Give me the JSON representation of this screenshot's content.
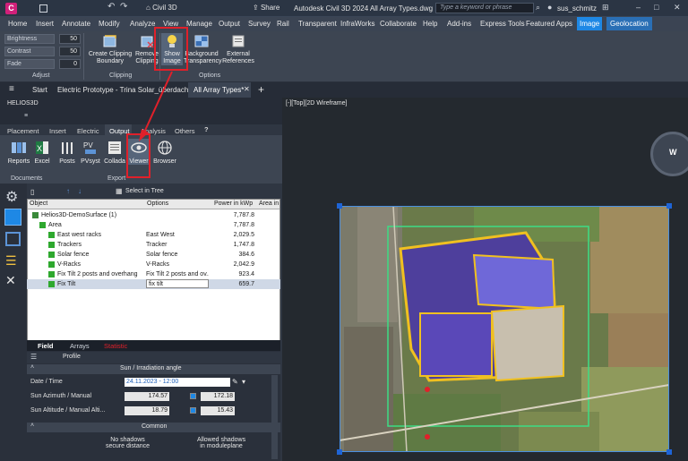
{
  "titlebar": {
    "app_letter": "C",
    "app_name": "Civil 3D",
    "share": "Share",
    "title": "Autodesk Civil 3D 2024    All Array Types.dwg",
    "search_placeholder": "Type a keyword or phrase",
    "user": "sus_schmitz"
  },
  "menubar": [
    "Home",
    "Insert",
    "Annotate",
    "Modify",
    "Analyze",
    "View",
    "Manage",
    "Output",
    "Survey",
    "Rail",
    "Transparent",
    "InfraWorks",
    "Collaborate",
    "Help",
    "Add-ins",
    "Express Tools",
    "Featured Apps",
    "Image",
    "Geolocation"
  ],
  "ribbon": {
    "adjust": {
      "rows": [
        {
          "label": "Brightness",
          "value": "50"
        },
        {
          "label": "Contrast",
          "value": "50"
        },
        {
          "label": "Fade",
          "value": "0"
        }
      ],
      "panel": "Adjust"
    },
    "clipping": {
      "create": "Create Clipping Boundary",
      "remove": "Remove Clipping",
      "panel": "Clipping"
    },
    "options": {
      "show_image": "Show Image",
      "background_transparency": "Background Transparency",
      "external_references": "External References",
      "panel": "Options"
    }
  },
  "doctabs": {
    "start": "Start",
    "tab1": "Electric Prototype - Trina Solar_überdacht*",
    "tab2": "All Array Types*"
  },
  "helios": {
    "title": "HELIOS3D",
    "tabs": [
      "Placement",
      "Insert",
      "Electric",
      "Output",
      "Analysis",
      "Others",
      "?"
    ],
    "buttons": [
      "Reports",
      "Excel",
      "Posts",
      "PVsyst",
      "Collada",
      "Viewer",
      "Browser"
    ],
    "groups": {
      "documents": "Documents",
      "export": "Export"
    },
    "select_in_tree": "Select in Tree",
    "grid_headers": [
      "Object",
      "Options",
      "Power in kWp",
      "Area in"
    ],
    "rows": [
      {
        "name": "Helios3D-DemoSurface (1)",
        "option": "",
        "power": "7,787.8"
      },
      {
        "name": "Area",
        "option": "",
        "power": "7,787.8"
      },
      {
        "name": "East west racks",
        "option": "East West",
        "power": "2,029.5"
      },
      {
        "name": "Trackers",
        "option": "Tracker",
        "power": "1,747.8"
      },
      {
        "name": "Solar fence",
        "option": "Solar fence",
        "power": "384.6"
      },
      {
        "name": "V-Racks",
        "option": "V-Racks",
        "power": "2,042.9"
      },
      {
        "name": "Fix Tilt 2 posts and overhang",
        "option": "Fix Tilt 2 posts and ov...",
        "power": "923.4"
      },
      {
        "name": "Fix Tilt",
        "option": "fix tilt",
        "power": "659.7"
      }
    ]
  },
  "field": {
    "tabs": [
      "Field",
      "Arrays",
      "Statistic"
    ],
    "profile": "Profile",
    "section_title": "Sun / Irradiation angle",
    "date_label": "Date / Time",
    "date_value": "24.11.2023 - 12:00",
    "azimuth_label": "Sun Azimuth / Manual",
    "azimuth_value": "174.57",
    "azimuth_manual": "172.18",
    "altitude_label": "Sun Altitude / Manual Alti...",
    "altitude_value": "18.79",
    "altitude_manual": "15.43",
    "common": "Common",
    "no_shadows_1": "No shadows",
    "no_shadows_2": "secure distance",
    "allowed_1": "Allowed shadows",
    "allowed_2": "in moduleplane"
  },
  "viewport": {
    "label": "[-][Top][2D Wireframe]",
    "compass": "W"
  },
  "colors": {
    "accent": "#1e88e5",
    "highlight": "#e0202a"
  }
}
